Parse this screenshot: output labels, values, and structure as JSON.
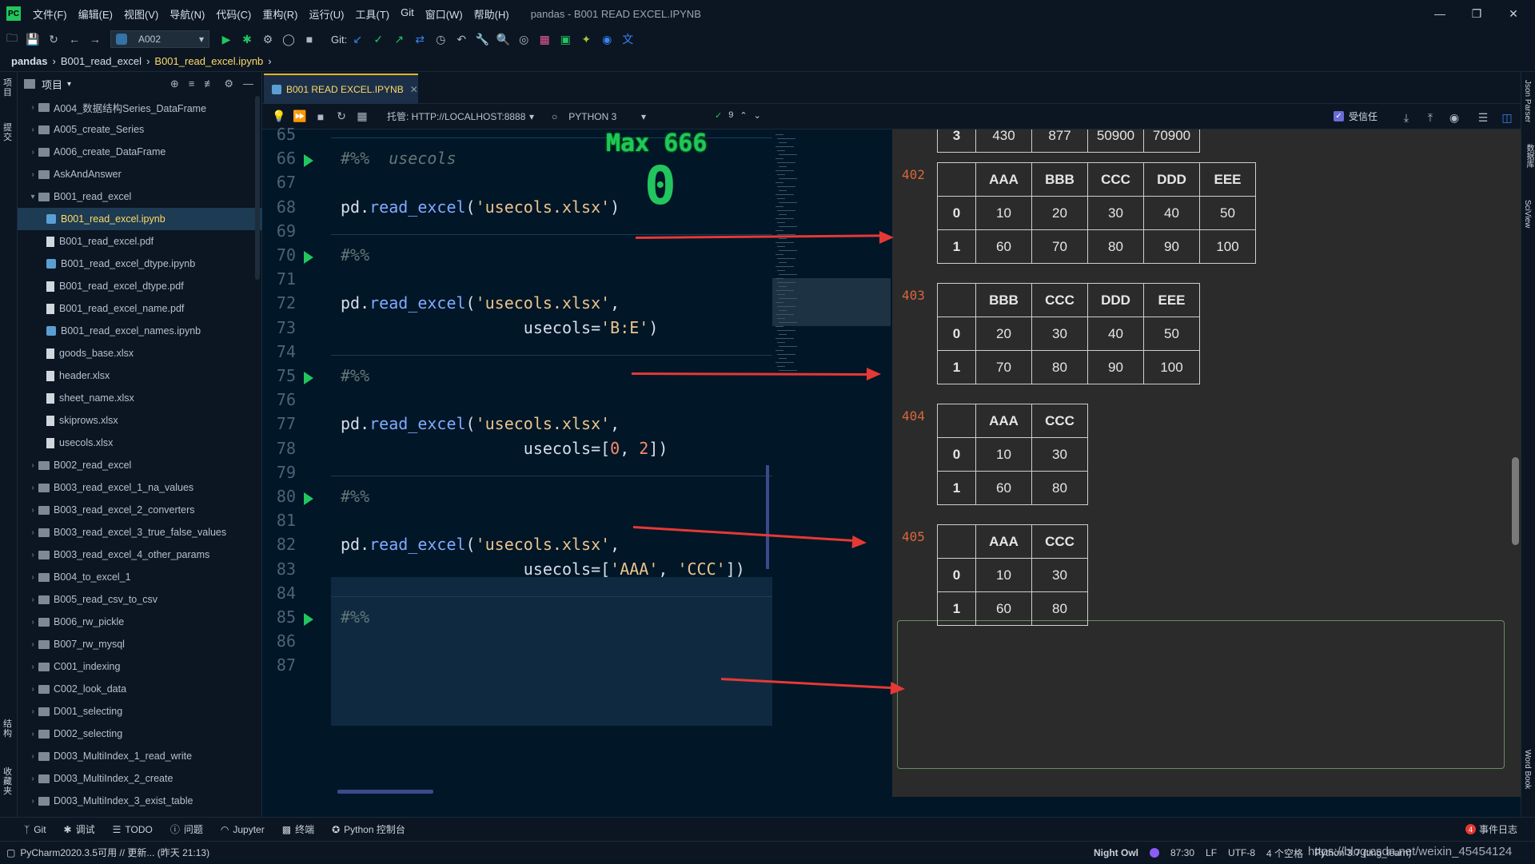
{
  "menu": {
    "logo": "PC",
    "items": [
      "文件(F)",
      "编辑(E)",
      "视图(V)",
      "导航(N)",
      "代码(C)",
      "重构(R)",
      "运行(U)",
      "工具(T)",
      "Git",
      "窗口(W)",
      "帮助(H)"
    ],
    "window_title": "pandas - B001 READ EXCEL.IPYNB"
  },
  "toolbar": {
    "config_name": "A002",
    "git_label": "Git:"
  },
  "breadcrumb": {
    "items": [
      "pandas",
      "B001_read_excel",
      "B001_read_excel.ipynb"
    ]
  },
  "project": {
    "title": "项目",
    "items": [
      {
        "label": "A004_数据结构Series_DataFrame",
        "type": "folder",
        "indent": 1
      },
      {
        "label": "A005_create_Series",
        "type": "folder",
        "indent": 1
      },
      {
        "label": "A006_create_DataFrame",
        "type": "folder",
        "indent": 1
      },
      {
        "label": "AskAndAnswer",
        "type": "folder",
        "indent": 1
      },
      {
        "label": "B001_read_excel",
        "type": "folder",
        "indent": 1,
        "open": true
      },
      {
        "label": "B001_read_excel.ipynb",
        "type": "notebook",
        "indent": 2,
        "selected": true
      },
      {
        "label": "B001_read_excel.pdf",
        "type": "file",
        "indent": 2
      },
      {
        "label": "B001_read_excel_dtype.ipynb",
        "type": "notebook",
        "indent": 2
      },
      {
        "label": "B001_read_excel_dtype.pdf",
        "type": "file",
        "indent": 2
      },
      {
        "label": "B001_read_excel_name.pdf",
        "type": "file",
        "indent": 2
      },
      {
        "label": "B001_read_excel_names.ipynb",
        "type": "notebook",
        "indent": 2
      },
      {
        "label": "goods_base.xlsx",
        "type": "file",
        "indent": 2
      },
      {
        "label": "header.xlsx",
        "type": "file",
        "indent": 2
      },
      {
        "label": "sheet_name.xlsx",
        "type": "file",
        "indent": 2
      },
      {
        "label": "skiprows.xlsx",
        "type": "file",
        "indent": 2
      },
      {
        "label": "usecols.xlsx",
        "type": "file",
        "indent": 2
      },
      {
        "label": "B002_read_excel",
        "type": "folder",
        "indent": 1
      },
      {
        "label": "B003_read_excel_1_na_values",
        "type": "folder",
        "indent": 1
      },
      {
        "label": "B003_read_excel_2_converters",
        "type": "folder",
        "indent": 1
      },
      {
        "label": "B003_read_excel_3_true_false_values",
        "type": "folder",
        "indent": 1
      },
      {
        "label": "B003_read_excel_4_other_params",
        "type": "folder",
        "indent": 1
      },
      {
        "label": "B004_to_excel_1",
        "type": "folder",
        "indent": 1
      },
      {
        "label": "B005_read_csv_to_csv",
        "type": "folder",
        "indent": 1
      },
      {
        "label": "B006_rw_pickle",
        "type": "folder",
        "indent": 1
      },
      {
        "label": "B007_rw_mysql",
        "type": "folder",
        "indent": 1
      },
      {
        "label": "C001_indexing",
        "type": "folder",
        "indent": 1
      },
      {
        "label": "C002_look_data",
        "type": "folder",
        "indent": 1
      },
      {
        "label": "D001_selecting",
        "type": "folder",
        "indent": 1
      },
      {
        "label": "D002_selecting",
        "type": "folder",
        "indent": 1
      },
      {
        "label": "D003_MultiIndex_1_read_write",
        "type": "folder",
        "indent": 1
      },
      {
        "label": "D003_MultiIndex_2_create",
        "type": "folder",
        "indent": 1
      },
      {
        "label": "D003_MultiIndex_3_exist_table",
        "type": "folder",
        "indent": 1
      }
    ]
  },
  "editor": {
    "tab_label": "B001 READ EXCEL.IPYNB",
    "managed_label": "托管: HTTP://LOCALHOST:8888",
    "kernel": "PYTHON 3",
    "inspection_count": "9",
    "trusted_label": "受信任",
    "overlay_text": "Max 666",
    "overlay_big": "0"
  },
  "code_lines": [
    {
      "n": "65",
      "parts": []
    },
    {
      "n": "66",
      "run": true,
      "parts": [
        {
          "c": "cmt",
          "t": "#%%  usecols"
        }
      ]
    },
    {
      "n": "67",
      "parts": []
    },
    {
      "n": "68",
      "parts": [
        {
          "c": "",
          "t": "pd."
        },
        {
          "c": "fn",
          "t": "read_excel"
        },
        {
          "c": "",
          "t": "("
        },
        {
          "c": "st",
          "t": "'usecols.xlsx'"
        },
        {
          "c": "",
          "t": ")"
        }
      ]
    },
    {
      "n": "69",
      "parts": []
    },
    {
      "n": "70",
      "run": true,
      "parts": [
        {
          "c": "cmt",
          "t": "#%%"
        }
      ]
    },
    {
      "n": "71",
      "parts": []
    },
    {
      "n": "72",
      "parts": [
        {
          "c": "",
          "t": "pd."
        },
        {
          "c": "fn",
          "t": "read_excel"
        },
        {
          "c": "",
          "t": "("
        },
        {
          "c": "st",
          "t": "'usecols.xlsx'"
        },
        {
          "c": "",
          "t": ","
        }
      ]
    },
    {
      "n": "73",
      "parts": [
        {
          "c": "",
          "t": "                   usecols="
        },
        {
          "c": "st",
          "t": "'B:E'"
        },
        {
          "c": "",
          "t": ")"
        }
      ]
    },
    {
      "n": "74",
      "parts": []
    },
    {
      "n": "75",
      "run": true,
      "parts": [
        {
          "c": "cmt",
          "t": "#%%"
        }
      ]
    },
    {
      "n": "76",
      "parts": []
    },
    {
      "n": "77",
      "parts": [
        {
          "c": "",
          "t": "pd."
        },
        {
          "c": "fn",
          "t": "read_excel"
        },
        {
          "c": "",
          "t": "("
        },
        {
          "c": "st",
          "t": "'usecols.xlsx'"
        },
        {
          "c": "",
          "t": ","
        }
      ]
    },
    {
      "n": "78",
      "parts": [
        {
          "c": "",
          "t": "                   usecols=["
        },
        {
          "c": "nm",
          "t": "0"
        },
        {
          "c": "",
          "t": ", "
        },
        {
          "c": "nm",
          "t": "2"
        },
        {
          "c": "",
          "t": "])"
        }
      ]
    },
    {
      "n": "79",
      "parts": []
    },
    {
      "n": "80",
      "run": true,
      "parts": [
        {
          "c": "cmt",
          "t": "#%%"
        }
      ]
    },
    {
      "n": "81",
      "parts": []
    },
    {
      "n": "82",
      "parts": [
        {
          "c": "",
          "t": "pd."
        },
        {
          "c": "fn",
          "t": "read_excel"
        },
        {
          "c": "",
          "t": "("
        },
        {
          "c": "st",
          "t": "'usecols.xlsx'"
        },
        {
          "c": "",
          "t": ","
        }
      ]
    },
    {
      "n": "83",
      "parts": [
        {
          "c": "",
          "t": "                   usecols=["
        },
        {
          "c": "st",
          "t": "'AAA'"
        },
        {
          "c": "",
          "t": ", "
        },
        {
          "c": "st",
          "t": "'CCC'"
        },
        {
          "c": "",
          "t": "])"
        }
      ]
    },
    {
      "n": "84",
      "parts": []
    },
    {
      "n": "85",
      "run": true,
      "parts": [
        {
          "c": "cmt",
          "t": "#%%"
        }
      ]
    },
    {
      "n": "86",
      "parts": []
    },
    {
      "n": "87",
      "parts": []
    }
  ],
  "outputs": [
    {
      "label": "",
      "headers": [],
      "rows": [
        [
          "3",
          "430",
          "877",
          "50900",
          "70900"
        ]
      ]
    },
    {
      "label": "402",
      "headers": [
        "",
        "AAA",
        "BBB",
        "CCC",
        "DDD",
        "EEE"
      ],
      "rows": [
        [
          "0",
          "10",
          "20",
          "30",
          "40",
          "50"
        ],
        [
          "1",
          "60",
          "70",
          "80",
          "90",
          "100"
        ]
      ]
    },
    {
      "label": "403",
      "headers": [
        "",
        "BBB",
        "CCC",
        "DDD",
        "EEE"
      ],
      "rows": [
        [
          "0",
          "20",
          "30",
          "40",
          "50"
        ],
        [
          "1",
          "70",
          "80",
          "90",
          "100"
        ]
      ]
    },
    {
      "label": "404",
      "headers": [
        "",
        "AAA",
        "CCC"
      ],
      "rows": [
        [
          "0",
          "10",
          "30"
        ],
        [
          "1",
          "60",
          "80"
        ]
      ]
    },
    {
      "label": "405",
      "headers": [
        "",
        "AAA",
        "CCC"
      ],
      "rows": [
        [
          "0",
          "10",
          "30"
        ],
        [
          "1",
          "60",
          "80"
        ]
      ]
    }
  ],
  "bottom_tabs": [
    "Git",
    "调试",
    "TODO",
    "问题",
    "Jupyter",
    "终端",
    "Python 控制台"
  ],
  "event_log": "事件日志",
  "event_count": "4",
  "status": {
    "left": "PyCharm2020.3.5可用 // 更新... (昨天 21:13)",
    "theme": "Night Owl",
    "position": "87:30",
    "line_sep": "LF",
    "encoding": "UTF-8",
    "indent": "4 个空格",
    "interpreter": "Python 3.7 (ting_learn)",
    "watermark": "https://blog.csdn.net/weixin_45454124"
  },
  "right_strip": [
    "Json Parser",
    "数据库",
    "SciView",
    "Word Book"
  ],
  "left_strip": [
    "项目",
    "提交",
    "结构",
    "收藏夹"
  ]
}
